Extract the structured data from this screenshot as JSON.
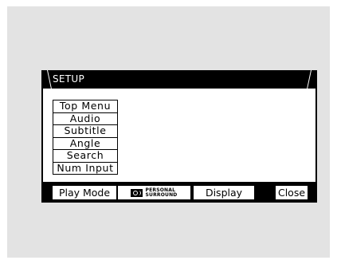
{
  "window": {
    "title": "SETUP"
  },
  "menu": {
    "items": [
      {
        "label": "Top Menu"
      },
      {
        "label": "Audio"
      },
      {
        "label": "Subtitle"
      },
      {
        "label": "Angle"
      },
      {
        "label": "Search"
      },
      {
        "label": "Num Input"
      }
    ]
  },
  "bottom_bar": {
    "play_mode_label": "Play Mode",
    "surround_label_line1": "PERSONAL",
    "surround_label_line2": "SURROUND",
    "surround_icon": "personal-surround-icon",
    "display_label": "Display",
    "close_label": "Close"
  },
  "colors": {
    "frame": "#000000",
    "screen_bg": "#ffffff",
    "backdrop": "#e3e3e3"
  }
}
